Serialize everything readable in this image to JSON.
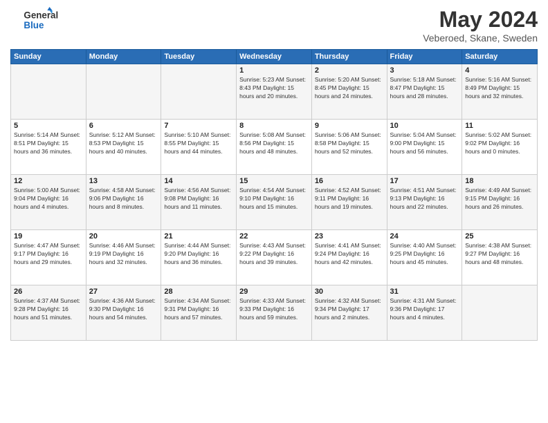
{
  "header": {
    "logo_line1": "General",
    "logo_line2": "Blue",
    "month": "May 2024",
    "location": "Veberoed, Skane, Sweden"
  },
  "weekdays": [
    "Sunday",
    "Monday",
    "Tuesday",
    "Wednesday",
    "Thursday",
    "Friday",
    "Saturday"
  ],
  "weeks": [
    [
      {
        "day": "",
        "info": ""
      },
      {
        "day": "",
        "info": ""
      },
      {
        "day": "",
        "info": ""
      },
      {
        "day": "1",
        "info": "Sunrise: 5:23 AM\nSunset: 8:43 PM\nDaylight: 15 hours\nand 20 minutes."
      },
      {
        "day": "2",
        "info": "Sunrise: 5:20 AM\nSunset: 8:45 PM\nDaylight: 15 hours\nand 24 minutes."
      },
      {
        "day": "3",
        "info": "Sunrise: 5:18 AM\nSunset: 8:47 PM\nDaylight: 15 hours\nand 28 minutes."
      },
      {
        "day": "4",
        "info": "Sunrise: 5:16 AM\nSunset: 8:49 PM\nDaylight: 15 hours\nand 32 minutes."
      }
    ],
    [
      {
        "day": "5",
        "info": "Sunrise: 5:14 AM\nSunset: 8:51 PM\nDaylight: 15 hours\nand 36 minutes."
      },
      {
        "day": "6",
        "info": "Sunrise: 5:12 AM\nSunset: 8:53 PM\nDaylight: 15 hours\nand 40 minutes."
      },
      {
        "day": "7",
        "info": "Sunrise: 5:10 AM\nSunset: 8:55 PM\nDaylight: 15 hours\nand 44 minutes."
      },
      {
        "day": "8",
        "info": "Sunrise: 5:08 AM\nSunset: 8:56 PM\nDaylight: 15 hours\nand 48 minutes."
      },
      {
        "day": "9",
        "info": "Sunrise: 5:06 AM\nSunset: 8:58 PM\nDaylight: 15 hours\nand 52 minutes."
      },
      {
        "day": "10",
        "info": "Sunrise: 5:04 AM\nSunset: 9:00 PM\nDaylight: 15 hours\nand 56 minutes."
      },
      {
        "day": "11",
        "info": "Sunrise: 5:02 AM\nSunset: 9:02 PM\nDaylight: 16 hours\nand 0 minutes."
      }
    ],
    [
      {
        "day": "12",
        "info": "Sunrise: 5:00 AM\nSunset: 9:04 PM\nDaylight: 16 hours\nand 4 minutes."
      },
      {
        "day": "13",
        "info": "Sunrise: 4:58 AM\nSunset: 9:06 PM\nDaylight: 16 hours\nand 8 minutes."
      },
      {
        "day": "14",
        "info": "Sunrise: 4:56 AM\nSunset: 9:08 PM\nDaylight: 16 hours\nand 11 minutes."
      },
      {
        "day": "15",
        "info": "Sunrise: 4:54 AM\nSunset: 9:10 PM\nDaylight: 16 hours\nand 15 minutes."
      },
      {
        "day": "16",
        "info": "Sunrise: 4:52 AM\nSunset: 9:11 PM\nDaylight: 16 hours\nand 19 minutes."
      },
      {
        "day": "17",
        "info": "Sunrise: 4:51 AM\nSunset: 9:13 PM\nDaylight: 16 hours\nand 22 minutes."
      },
      {
        "day": "18",
        "info": "Sunrise: 4:49 AM\nSunset: 9:15 PM\nDaylight: 16 hours\nand 26 minutes."
      }
    ],
    [
      {
        "day": "19",
        "info": "Sunrise: 4:47 AM\nSunset: 9:17 PM\nDaylight: 16 hours\nand 29 minutes."
      },
      {
        "day": "20",
        "info": "Sunrise: 4:46 AM\nSunset: 9:19 PM\nDaylight: 16 hours\nand 32 minutes."
      },
      {
        "day": "21",
        "info": "Sunrise: 4:44 AM\nSunset: 9:20 PM\nDaylight: 16 hours\nand 36 minutes."
      },
      {
        "day": "22",
        "info": "Sunrise: 4:43 AM\nSunset: 9:22 PM\nDaylight: 16 hours\nand 39 minutes."
      },
      {
        "day": "23",
        "info": "Sunrise: 4:41 AM\nSunset: 9:24 PM\nDaylight: 16 hours\nand 42 minutes."
      },
      {
        "day": "24",
        "info": "Sunrise: 4:40 AM\nSunset: 9:25 PM\nDaylight: 16 hours\nand 45 minutes."
      },
      {
        "day": "25",
        "info": "Sunrise: 4:38 AM\nSunset: 9:27 PM\nDaylight: 16 hours\nand 48 minutes."
      }
    ],
    [
      {
        "day": "26",
        "info": "Sunrise: 4:37 AM\nSunset: 9:28 PM\nDaylight: 16 hours\nand 51 minutes."
      },
      {
        "day": "27",
        "info": "Sunrise: 4:36 AM\nSunset: 9:30 PM\nDaylight: 16 hours\nand 54 minutes."
      },
      {
        "day": "28",
        "info": "Sunrise: 4:34 AM\nSunset: 9:31 PM\nDaylight: 16 hours\nand 57 minutes."
      },
      {
        "day": "29",
        "info": "Sunrise: 4:33 AM\nSunset: 9:33 PM\nDaylight: 16 hours\nand 59 minutes."
      },
      {
        "day": "30",
        "info": "Sunrise: 4:32 AM\nSunset: 9:34 PM\nDaylight: 17 hours\nand 2 minutes."
      },
      {
        "day": "31",
        "info": "Sunrise: 4:31 AM\nSunset: 9:36 PM\nDaylight: 17 hours\nand 4 minutes."
      },
      {
        "day": "",
        "info": ""
      }
    ]
  ]
}
